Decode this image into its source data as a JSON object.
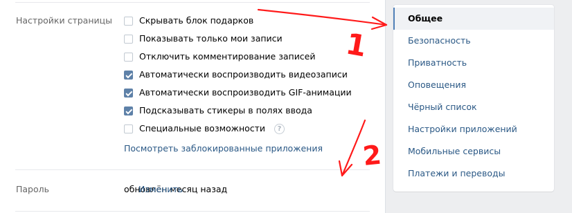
{
  "page_settings": {
    "label": "Настройки страницы",
    "options": [
      {
        "label": "Скрывать блок подарков",
        "checked": false
      },
      {
        "label": "Показывать только мои записи",
        "checked": false
      },
      {
        "label": "Отключить комментирование записей",
        "checked": false
      },
      {
        "label": "Автоматически воспроизводить видеозаписи",
        "checked": true
      },
      {
        "label": "Автоматически воспроизводить GIF-анимации",
        "checked": true
      },
      {
        "label": "Подсказывать стикеры в полях ввода",
        "checked": true
      },
      {
        "label": "Специальные возможности",
        "checked": false
      }
    ],
    "help_glyph": "?",
    "blocked_apps_link": "Посмотреть заблокированные приложения"
  },
  "password": {
    "label": "Пароль",
    "value": "обновлён месяц назад",
    "change_link": "Изменить"
  },
  "menu": {
    "items": [
      {
        "label": "Общее",
        "active": true
      },
      {
        "label": "Безопасность",
        "active": false
      },
      {
        "label": "Приватность",
        "active": false
      },
      {
        "label": "Оповещения",
        "active": false
      },
      {
        "label": "Чёрный список",
        "active": false
      },
      {
        "label": "Настройки приложений",
        "active": false
      },
      {
        "label": "Мобильные сервисы",
        "active": false
      },
      {
        "label": "Платежи и переводы",
        "active": false
      }
    ]
  },
  "annotations": {
    "marker_1": "1",
    "marker_2": "2",
    "color": "#ff1a1a"
  },
  "colors": {
    "link": "#2a5885",
    "accent": "#5181b8",
    "checkbox_checked": "#5e81a8",
    "background": "#edeef0"
  }
}
